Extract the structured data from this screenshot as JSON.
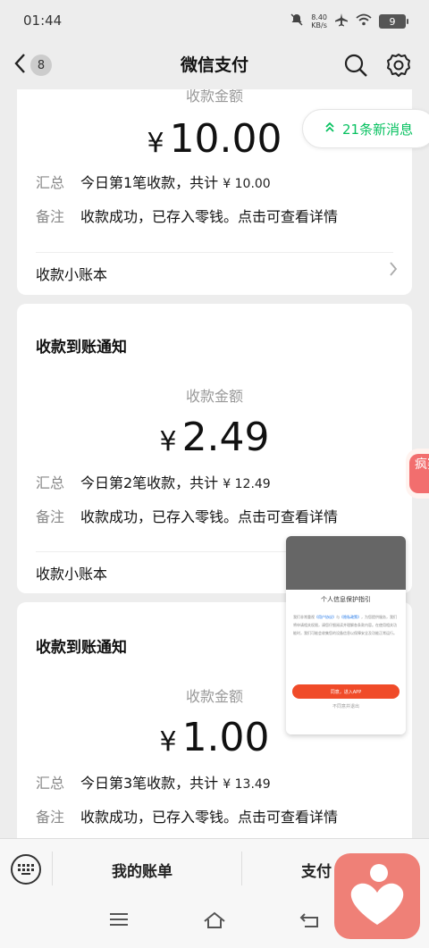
{
  "status_bar": {
    "time": "01:44",
    "net_speed": "8.40",
    "net_unit": "KB/s",
    "battery": "9"
  },
  "nav": {
    "back_count": "8",
    "title": "微信支付"
  },
  "new_messages": "21条新消息",
  "cards": [
    {
      "amount_label": "收款金额",
      "currency": "¥",
      "amount": "10.00",
      "summary_key": "汇总",
      "summary_prefix": "今日第1笔收款，共计",
      "summary_total": "¥ 10.00",
      "note_key": "备注",
      "note": "收款成功，已存入零钱。点击可查看详情",
      "ledger": "收款小账本"
    },
    {
      "title": "收款到账通知",
      "amount_label": "收款金额",
      "currency": "¥",
      "amount": "2.49",
      "summary_key": "汇总",
      "summary_prefix": "今日第2笔收款，共计",
      "summary_total": "¥ 12.49",
      "note_key": "备注",
      "note": "收款成功，已存入零钱。点击可查看详情",
      "ledger": "收款小账本"
    },
    {
      "title": "收款到账通知",
      "amount_label": "收款金额",
      "currency": "¥",
      "amount": "1.00",
      "summary_key": "汇总",
      "summary_prefix": "今日第3笔收款，共计",
      "summary_total": "¥ 13.49",
      "note_key": "备注",
      "note": "收款成功，已存入零钱。点击可查看详情"
    }
  ],
  "popup": {
    "title": "个人信息保护指引",
    "body_1": "我们非常重视",
    "link_1": "《用户协议》",
    "body_2": "与",
    "link_2": "《隐私政策》",
    "body_3": "，为您提供服务，我们将申请相关权限，请您仔细阅读并理解各条款内容。在使用相关功能时，我们可能会收集您的设备信息以保障安全及功能正常运行。",
    "button": "同意，进入APP",
    "decline": "不同意并退出"
  },
  "side_ad": {
    "text": "疯赛"
  },
  "bottom_bar": {
    "menu_1": "我的账单",
    "menu_2": "支付"
  },
  "colors": {
    "wechat_green": "#07c160",
    "background": "#ededed",
    "popup_button": "#f04b29"
  }
}
